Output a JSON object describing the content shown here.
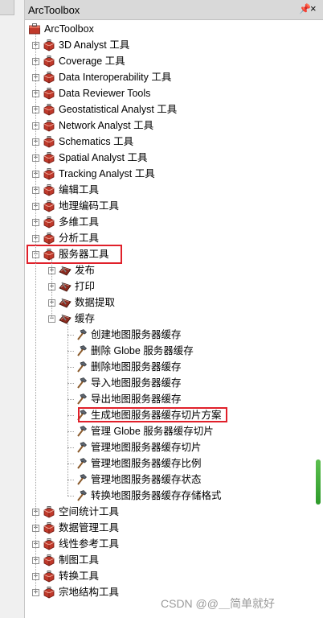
{
  "window": {
    "title": "ArcToolbox",
    "pin_glyph": "❙",
    "close_glyph": "×"
  },
  "root": {
    "label": "ArcToolbox",
    "icon": "toolbox-icon"
  },
  "toolboxes_top": [
    "3D Analyst 工具",
    "Coverage 工具",
    "Data Interoperability 工具",
    "Data Reviewer Tools",
    "Geostatistical Analyst 工具",
    "Network Analyst 工具",
    "Schematics 工具",
    "Spatial Analyst 工具",
    "Tracking Analyst 工具",
    "编辑工具",
    "地理编码工具",
    "多维工具",
    "分析工具"
  ],
  "server_toolbox": {
    "label": "服务器工具",
    "toolsets": [
      "发布",
      "打印",
      "数据提取",
      "缓存"
    ],
    "cache_tools": [
      "创建地图服务器缓存",
      "删除 Globe 服务器缓存",
      "删除地图服务器缓存",
      "导入地图服务器缓存",
      "导出地图服务器缓存",
      "生成地图服务器缓存切片方案",
      "管理 Globe 服务器缓存切片",
      "管理地图服务器缓存切片",
      "管理地图服务器缓存比例",
      "管理地图服务器缓存状态",
      "转换地图服务器缓存存储格式"
    ]
  },
  "toolboxes_bottom": [
    "空间统计工具",
    "数据管理工具",
    "线性参考工具",
    "制图工具",
    "转换工具",
    "宗地结构工具"
  ],
  "expander": {
    "collapsed": "+",
    "expanded": "−"
  },
  "watermark": "CSDN @@＿简单就好",
  "colors": {
    "highlight": "#e0202a",
    "toolbox_red": "#c0392b",
    "titlebar": "#d9d9d9"
  }
}
